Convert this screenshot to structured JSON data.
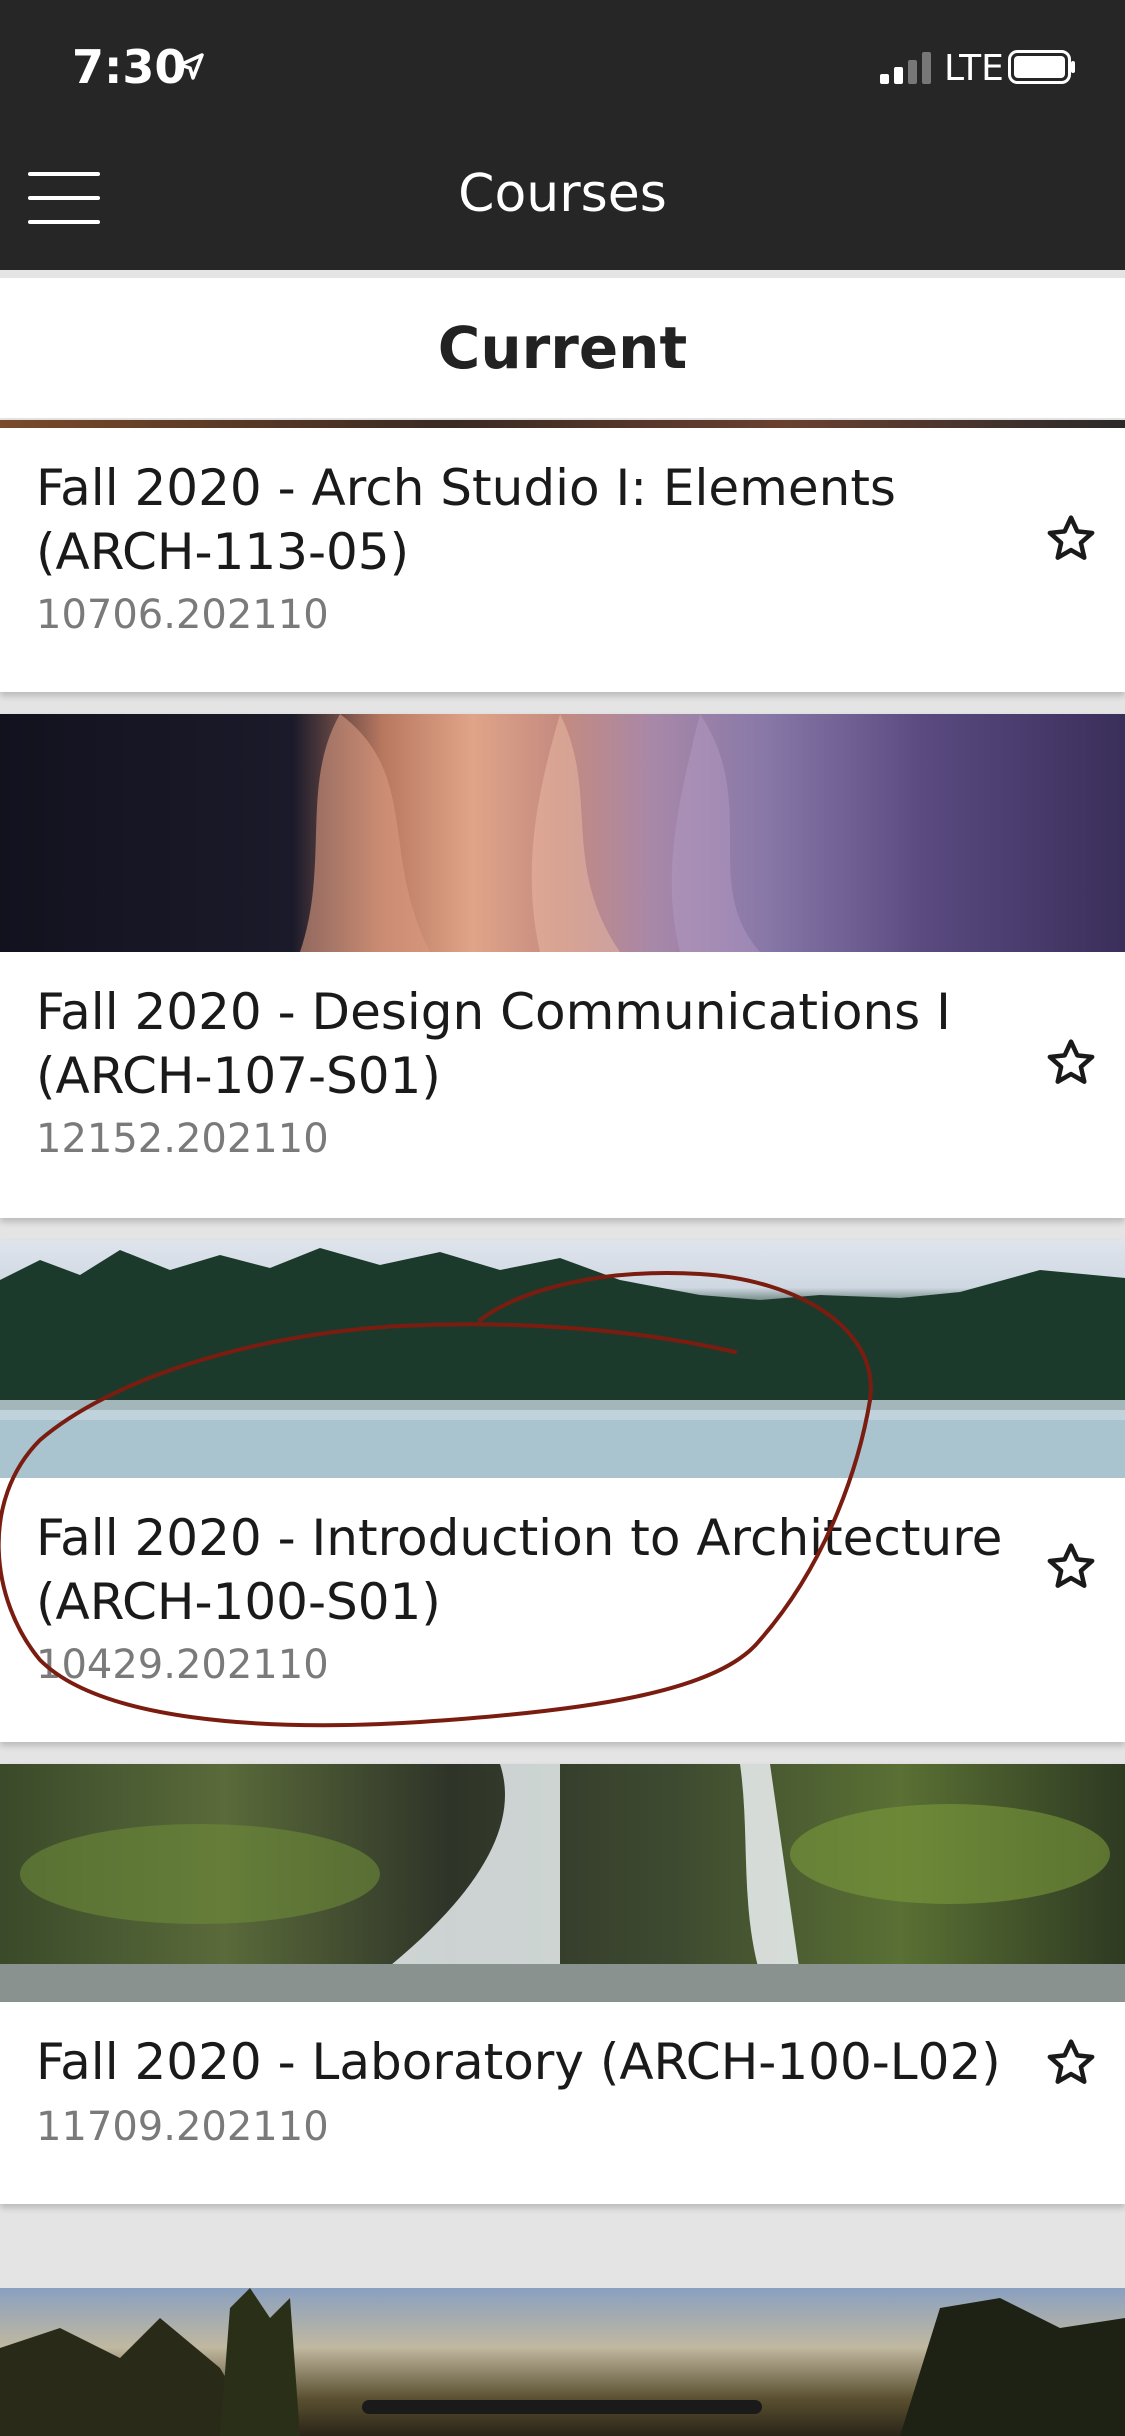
{
  "status_bar": {
    "time": "7:30",
    "network": "LTE"
  },
  "nav": {
    "title": "Courses",
    "menu_icon": "hamburger-menu-icon"
  },
  "section": {
    "title": "Current"
  },
  "courses": [
    {
      "title": "Fall 2020 - Arch Studio I: Elements (ARCH-113-05)",
      "id": "10706.202110",
      "image": "sunset-strip",
      "favorite_icon": "star-outline-icon"
    },
    {
      "title": "Fall 2020 - Design Communications I (ARCH-107-S01)",
      "id": "12152.202110",
      "image": "canyon-rock",
      "favorite_icon": "star-outline-icon"
    },
    {
      "title": "Fall 2020 - Introduction to Architecture (ARCH-100-S01)",
      "id": "10429.202110",
      "image": "misty-lake-forest",
      "favorite_icon": "star-outline-icon"
    },
    {
      "title": "Fall 2020 - Laboratory (ARCH-100-L02)",
      "id": "11709.202110",
      "image": "waterfall",
      "favorite_icon": "star-outline-icon"
    }
  ],
  "colors": {
    "nav_background": "#262626",
    "annotation_stroke": "#7a1d10"
  }
}
